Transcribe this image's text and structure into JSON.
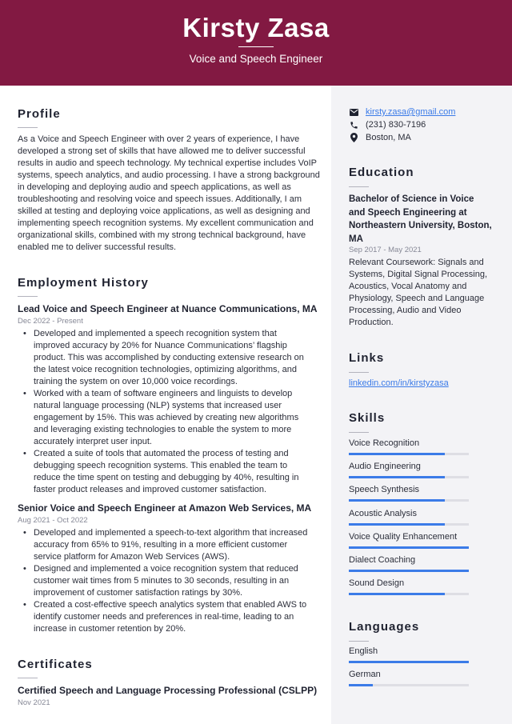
{
  "header": {
    "name": "Kirsty Zasa",
    "job_title": "Voice and Speech Engineer",
    "background_color": "#821942"
  },
  "profile": {
    "heading": "Profile",
    "lines": [
      "As a Voice and Speech Engineer with over 2 years of experience, I have",
      "developed a strong set of skills that have allowed me to deliver successful",
      "results in audio and speech technology. My technical expertise includes VoIP",
      "systems, speech analytics, and audio processing. I have a strong background",
      "in developing and deploying audio and speech applications, as well as",
      "troubleshooting and resolving voice and speech issues. Additionally, I am",
      "skilled at testing and deploying voice applications, as well as designing and",
      "implementing speech recognition systems. My excellent communication and",
      "organizational skills, combined with my strong technical background, have",
      "enabled me to deliver successful results."
    ]
  },
  "employment": {
    "heading": "Employment History",
    "jobs": [
      {
        "title": "Lead Voice and Speech Engineer at Nuance Communications, MA",
        "dates": "Dec 2022 - Present",
        "bullets": [
          "Developed and implemented a speech recognition system that improved accuracy by 20% for Nuance Communications’ flagship product. This was accomplished by conducting extensive research on the latest voice recognition technologies, optimizing algorithms, and training the system on over 10,000 voice recordings.",
          "Worked with a team of software engineers and linguists to develop natural language processing (NLP) systems that increased user engagement by 15%. This was achieved by creating new algorithms and leveraging existing technologies to enable the system to more accurately interpret user input.",
          "Created a suite of tools that automated the process of testing and debugging speech recognition systems. This enabled the team to reduce the time spent on testing and debugging by 40%, resulting in faster product releases and improved customer satisfaction."
        ]
      },
      {
        "title": "Senior Voice and Speech Engineer at Amazon Web Services, MA",
        "dates": "Aug 2021 - Oct 2022",
        "bullets": [
          "Developed and implemented a speech-to-text algorithm that increased accuracy from 65% to 91%, resulting in a more efficient customer service platform for Amazon Web Services (AWS).",
          "Designed and implemented a voice recognition system that reduced customer wait times from 5 minutes to 30 seconds, resulting in an improvement of customer satisfaction ratings by 30%.",
          "Created a cost-effective speech analytics system that enabled AWS to identify customer needs and preferences in real-time, leading to an increase in customer retention by 20%."
        ]
      }
    ]
  },
  "certificates": {
    "heading": "Certificates",
    "items": [
      {
        "title": "Certified Speech and Language Processing Professional (CSLPP)",
        "date": "Nov 2021"
      }
    ]
  },
  "contact": {
    "email": "kirsty.zasa@gmail.com",
    "phone": "(231) 830-7196",
    "location": "Boston, MA",
    "icons": [
      "envelope-icon",
      "phone-icon",
      "map-pin-icon"
    ]
  },
  "education": {
    "heading": "Education",
    "degree_lines": [
      "Bachelor of Science in Voice",
      "and Speech Engineering at",
      "Northeastern University, Boston,",
      "MA"
    ],
    "dates": "Sep 2017 - May 2021",
    "coursework_lines": [
      "Relevant Coursework: Signals and",
      "Systems, Digital Signal Processing,",
      "Acoustics, Vocal Anatomy and",
      "Physiology, Speech and Language",
      "Processing, Audio and Video",
      "Production."
    ]
  },
  "links": {
    "heading": "Links",
    "items": [
      "linkedin.com/in/kirstyzasa"
    ]
  },
  "skills": {
    "heading": "Skills",
    "items": [
      {
        "name": "Voice Recognition",
        "level": 0.8
      },
      {
        "name": "Audio Engineering",
        "level": 0.8
      },
      {
        "name": "Speech Synthesis",
        "level": 0.8
      },
      {
        "name": "Acoustic Analysis",
        "level": 0.8
      },
      {
        "name": "Voice Quality Enhancement",
        "level": 1.0
      },
      {
        "name": "Dialect Coaching",
        "level": 1.0
      },
      {
        "name": "Sound Design",
        "level": 0.8
      }
    ]
  },
  "languages": {
    "heading": "Languages",
    "items": [
      {
        "name": "English",
        "level": 1.0
      },
      {
        "name": "German",
        "level": 0.2
      }
    ]
  },
  "colors": {
    "accent": "#3b7be8",
    "sidebar_bg": "#f3f3f6"
  }
}
